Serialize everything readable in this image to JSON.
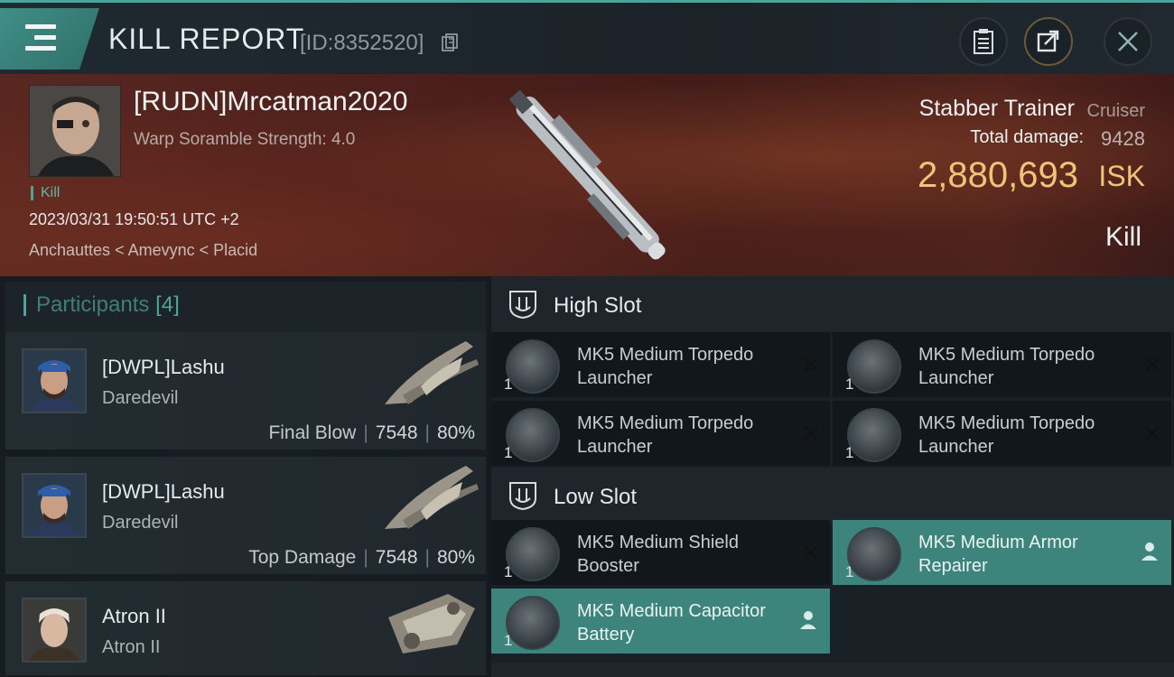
{
  "header": {
    "title": "KILL REPORT",
    "report_id": "[ID:8352520]"
  },
  "victim": {
    "name": "[RUDN]Mrcatman2020",
    "scramble": "Warp Soramble Strength: 4.0",
    "kill_tag": "Kill",
    "datetime": "2023/03/31 19:50:51 UTC +2",
    "location": "Anchauttes < Amevync < Placid",
    "ship_name": "Stabber Trainer",
    "ship_class": "Cruiser",
    "damage_label": "Total damage:",
    "damage_value": "9428",
    "isk_value": "2,880,693",
    "isk_unit": "ISK",
    "result": "Kill"
  },
  "participants": {
    "label": "Participants",
    "count": "[4]",
    "items": [
      {
        "name": "[DWPL]Lashu",
        "ship": "Daredevil",
        "role": "Final Blow",
        "damage": "7548",
        "percent": "80%"
      },
      {
        "name": "[DWPL]Lashu",
        "ship": "Daredevil",
        "role": "Top Damage",
        "damage": "7548",
        "percent": "80%"
      },
      {
        "name": "Atron II",
        "ship": "Atron II"
      }
    ]
  },
  "slots": {
    "high": {
      "label": "High Slot",
      "modules": [
        {
          "name": "MK5 Medium Torpedo Launcher",
          "qty": "1",
          "state": "destroyed"
        },
        {
          "name": "MK5 Medium Torpedo Launcher",
          "qty": "1",
          "state": "destroyed"
        },
        {
          "name": "MK5 Medium Torpedo Launcher",
          "qty": "1",
          "state": "destroyed"
        },
        {
          "name": "MK5 Medium Torpedo Launcher",
          "qty": "1",
          "state": "destroyed"
        }
      ]
    },
    "low": {
      "label": "Low Slot",
      "modules": [
        {
          "name": "MK5 Medium Shield Booster",
          "qty": "1",
          "state": "destroyed"
        },
        {
          "name": "MK5 Medium Armor Repairer",
          "qty": "1",
          "state": "dropped"
        },
        {
          "name": "MK5 Medium Capacitor Battery",
          "qty": "1",
          "state": "dropped"
        }
      ]
    }
  },
  "colors": {
    "accent": "#4fa39a",
    "isk": "#f2c27a",
    "dropped_bg": "#3c847c"
  }
}
